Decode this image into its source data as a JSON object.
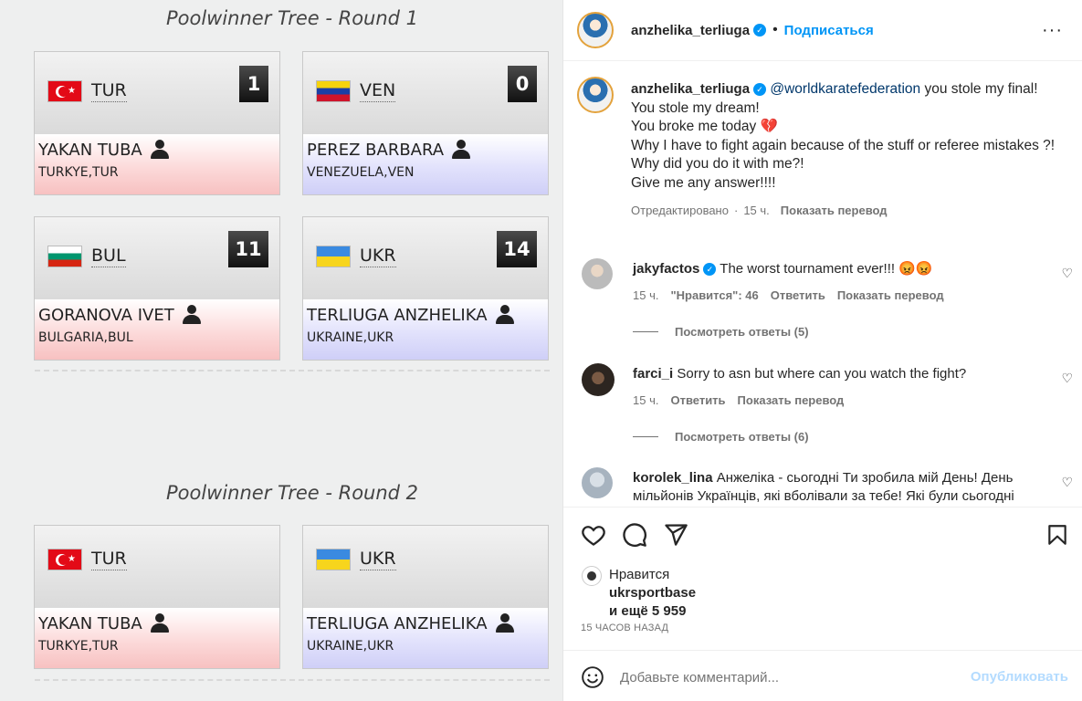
{
  "bracket": {
    "round1_title": "Poolwinner Tree - Round 1",
    "round2_title": "Poolwinner Tree - Round 2",
    "round1": [
      {
        "code": "TUR",
        "flag": "tur",
        "score": "1",
        "name": "YAKAN TUBA",
        "country": "TURKYE,TUR",
        "side": "red"
      },
      {
        "code": "VEN",
        "flag": "ven",
        "score": "0",
        "name": "PEREZ BARBARA",
        "country": "VENEZUELA,VEN",
        "side": "blue"
      },
      {
        "code": "BUL",
        "flag": "bul",
        "score": "11",
        "name": "GORANOVA IVET",
        "country": "BULGARIA,BUL",
        "side": "red"
      },
      {
        "code": "UKR",
        "flag": "ukr",
        "score": "14",
        "name": "TERLIUGA ANZHELIKA",
        "country": "UKRAINE,UKR",
        "side": "blue"
      }
    ],
    "round2": [
      {
        "code": "TUR",
        "flag": "tur",
        "name": "YAKAN TUBA",
        "country": "TURKYE,TUR",
        "side": "red"
      },
      {
        "code": "UKR",
        "flag": "ukr",
        "name": "TERLIUGA ANZHELIKA",
        "country": "UKRAINE,UKR",
        "side": "blue"
      }
    ]
  },
  "post": {
    "header_username": "anzhelika_terliuga",
    "follow_label": "Подписаться",
    "caption_username": "anzhelika_terliuga",
    "caption_mention": "@worldkaratefederation",
    "caption_lines": [
      "you stole my final!",
      "You stole my dream!",
      "You broke me today",
      "Why I have to fight again because of the stuff or referee mistakes ?!",
      "Why did you do it with me?!",
      "Give me any answer!!!!"
    ],
    "edited": "Отредактировано",
    "edited_time": "15 ч.",
    "translate": "Показать перевод"
  },
  "comments": [
    {
      "username": "jakyfactos",
      "verified": true,
      "text": "The worst tournament ever!!! 😡😡",
      "time": "15 ч.",
      "likes": "\"Нравится\": 46",
      "reply": "Ответить",
      "translate": "Показать перевод",
      "replies": "Посмотреть ответы (5)"
    },
    {
      "username": "farci_i",
      "verified": false,
      "text": "Sorry to asn but where can you watch the fight?",
      "time": "15 ч.",
      "reply": "Ответить",
      "translate": "Показать перевод",
      "replies": "Посмотреть ответы (6)"
    },
    {
      "username": "korolek_lina",
      "verified": false,
      "text": "Анжеліка - сьогодні Ти зробила мій День! День мільйонів Українців, які вболівали за тебе! Які були сьогодні"
    }
  ],
  "likes": {
    "label": "Нравится",
    "liker": "ukrsportbase",
    "others": "и ещё 5 959",
    "time": "15 ЧАСОВ НАЗАД"
  },
  "add_comment": {
    "placeholder": "Добавьте комментарий...",
    "publish": "Опубликовать"
  },
  "icons": [
    "more-icon",
    "heart-icon",
    "comment-icon",
    "share-icon",
    "bookmark-icon",
    "emoji-icon",
    "verified-icon",
    "person-icon"
  ]
}
